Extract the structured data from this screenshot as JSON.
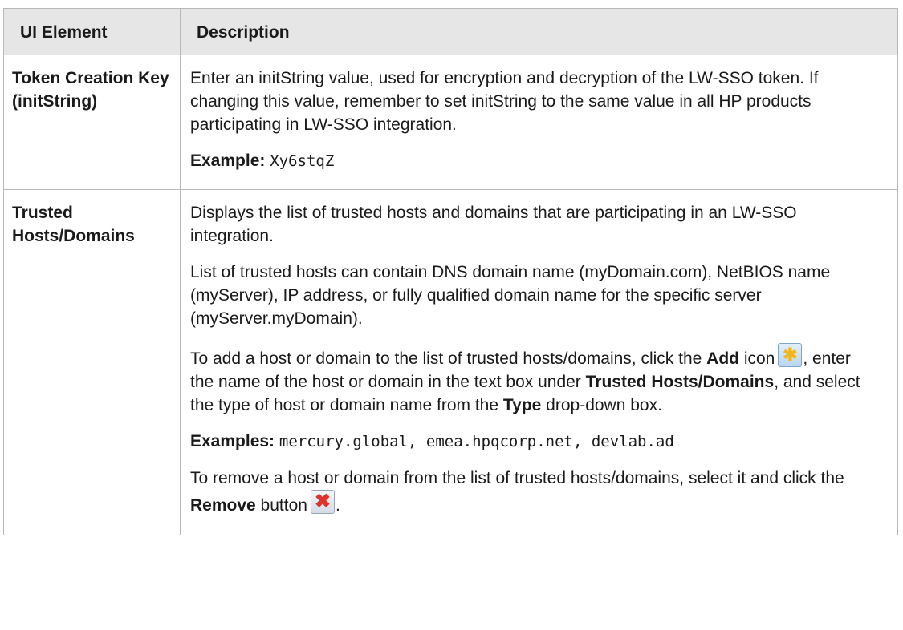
{
  "table": {
    "header": {
      "col1": "UI Element",
      "col2": "Description"
    },
    "rows": [
      {
        "element": "Token Creation Key (initString)",
        "p1": "Enter an initString value, used for encryption and decryption of the LW-SSO token. If changing this value, remember to set initString to the same value in all HP products participating in LW-SSO integration.",
        "example_label": "Example:",
        "example_value": "Xy6stqZ"
      },
      {
        "element": "Trusted Hosts/Domains",
        "p1": "Displays the list of trusted hosts and domains that are participating in an LW-SSO integration.",
        "p2": "List of trusted hosts can contain DNS domain name (myDomain.com), NetBIOS name (myServer), IP address, or fully qualified domain name for the specific server (myServer.myDomain).",
        "p3_a": "To add a host or domain to the list of trusted hosts/domains, click the ",
        "p3_add": "Add",
        "p3_b": " icon",
        "p3_c": ", enter the name of the host or domain in the text box under ",
        "p3_trusted": "Trusted Hosts/Domains",
        "p3_d": ", and select the type of host or domain name from the ",
        "p3_type": "Type",
        "p3_e": " drop-down box.",
        "examples_label": "Examples:",
        "examples_value": "mercury.global, emea.hpqcorp.net, devlab.ad",
        "p4_a": "To remove a host or domain from the list of trusted hosts/domains, select it and click the ",
        "p4_remove": "Remove",
        "p4_b": " button",
        "p4_c": "."
      }
    ]
  },
  "icons": {
    "add": "add-icon",
    "remove": "remove-icon",
    "add_glyph": "✱",
    "remove_glyph": "✖"
  }
}
